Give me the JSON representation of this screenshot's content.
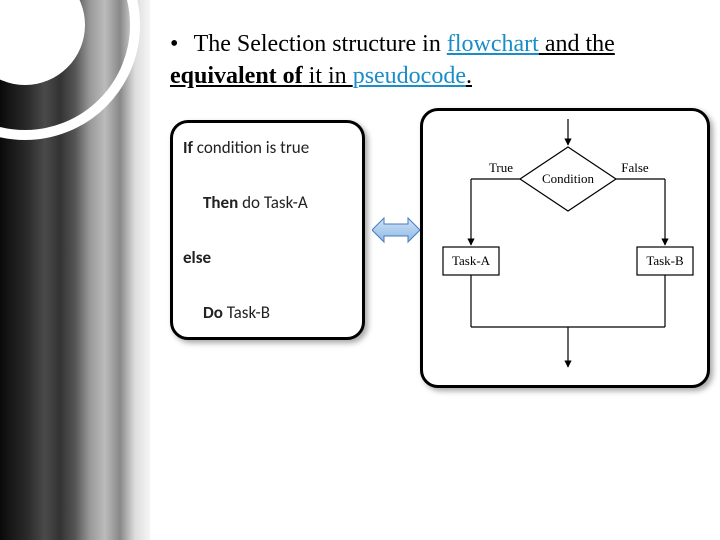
{
  "slide": {
    "bullet_prefix": "•",
    "text_parts": {
      "p1": "The Selection structure in ",
      "flowchart": "flowchart",
      "p2": " and the ",
      "equivalent_of": "equivalent of",
      "p3": " it in ",
      "pseudocode": "pseudocode",
      "period": "."
    }
  },
  "pseudocode": {
    "line1_kw": "If",
    "line1_rest": " condition is true",
    "line2_kw": "Then",
    "line2_rest": " do Task-A",
    "line3_kw": "else",
    "line4_kw": "Do",
    "line4_rest": " Task-B"
  },
  "flowchart_labels": {
    "condition": "Condition",
    "true": "True",
    "false": "False",
    "task_a": "Task-A",
    "task_b": "Task-B"
  }
}
